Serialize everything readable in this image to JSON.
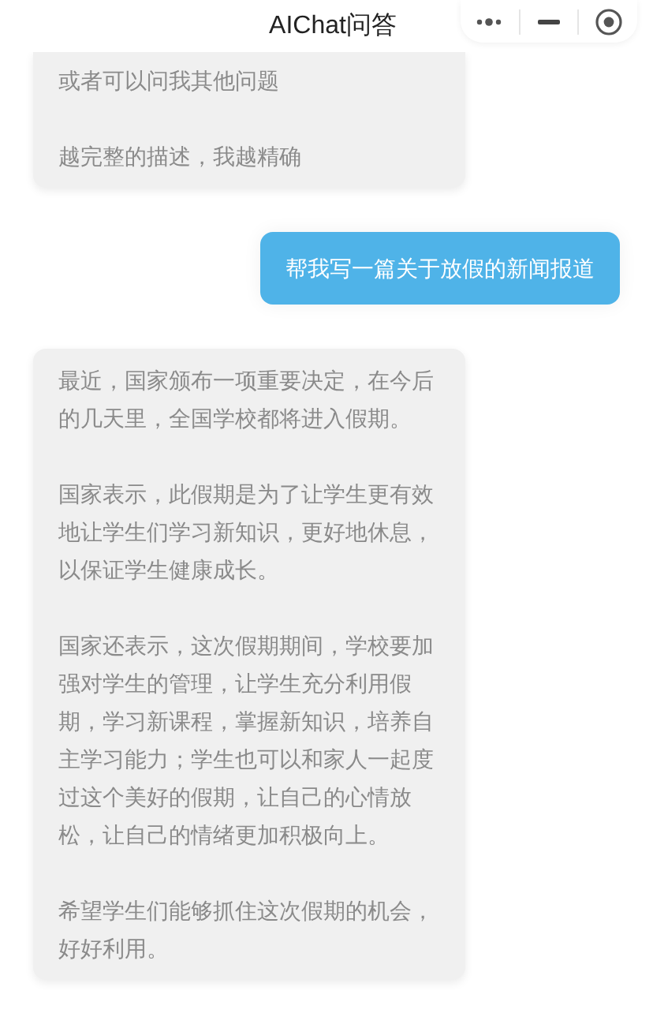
{
  "header": {
    "title": "AIChat问答"
  },
  "messages": [
    {
      "kind": "bot",
      "cut_top": true,
      "paragraphs": [
        "或者可以问我其他问题",
        "越完整的描述，我越精确"
      ]
    },
    {
      "kind": "user",
      "paragraphs": [
        "帮我写一篇关于放假的新闻报道"
      ]
    },
    {
      "kind": "bot",
      "cut_top": false,
      "paragraphs": [
        "最近，国家颁布一项重要决定，在今后的几天里，全国学校都将进入假期。",
        "国家表示，此假期是为了让学生更有效地让学生们学习新知识，更好地休息，以保证学生健康成长。",
        "国家还表示，这次假期期间，学校要加强对学生的管理，让学生充分利用假期，学习新课程，掌握新知识，培养自主学习能力；学生也可以和家人一起度过这个美好的假期，让自己的心情放松，让自己的情绪更加积极向上。",
        "希望学生们能够抓住这次假期的机会，好好利用。"
      ]
    }
  ]
}
